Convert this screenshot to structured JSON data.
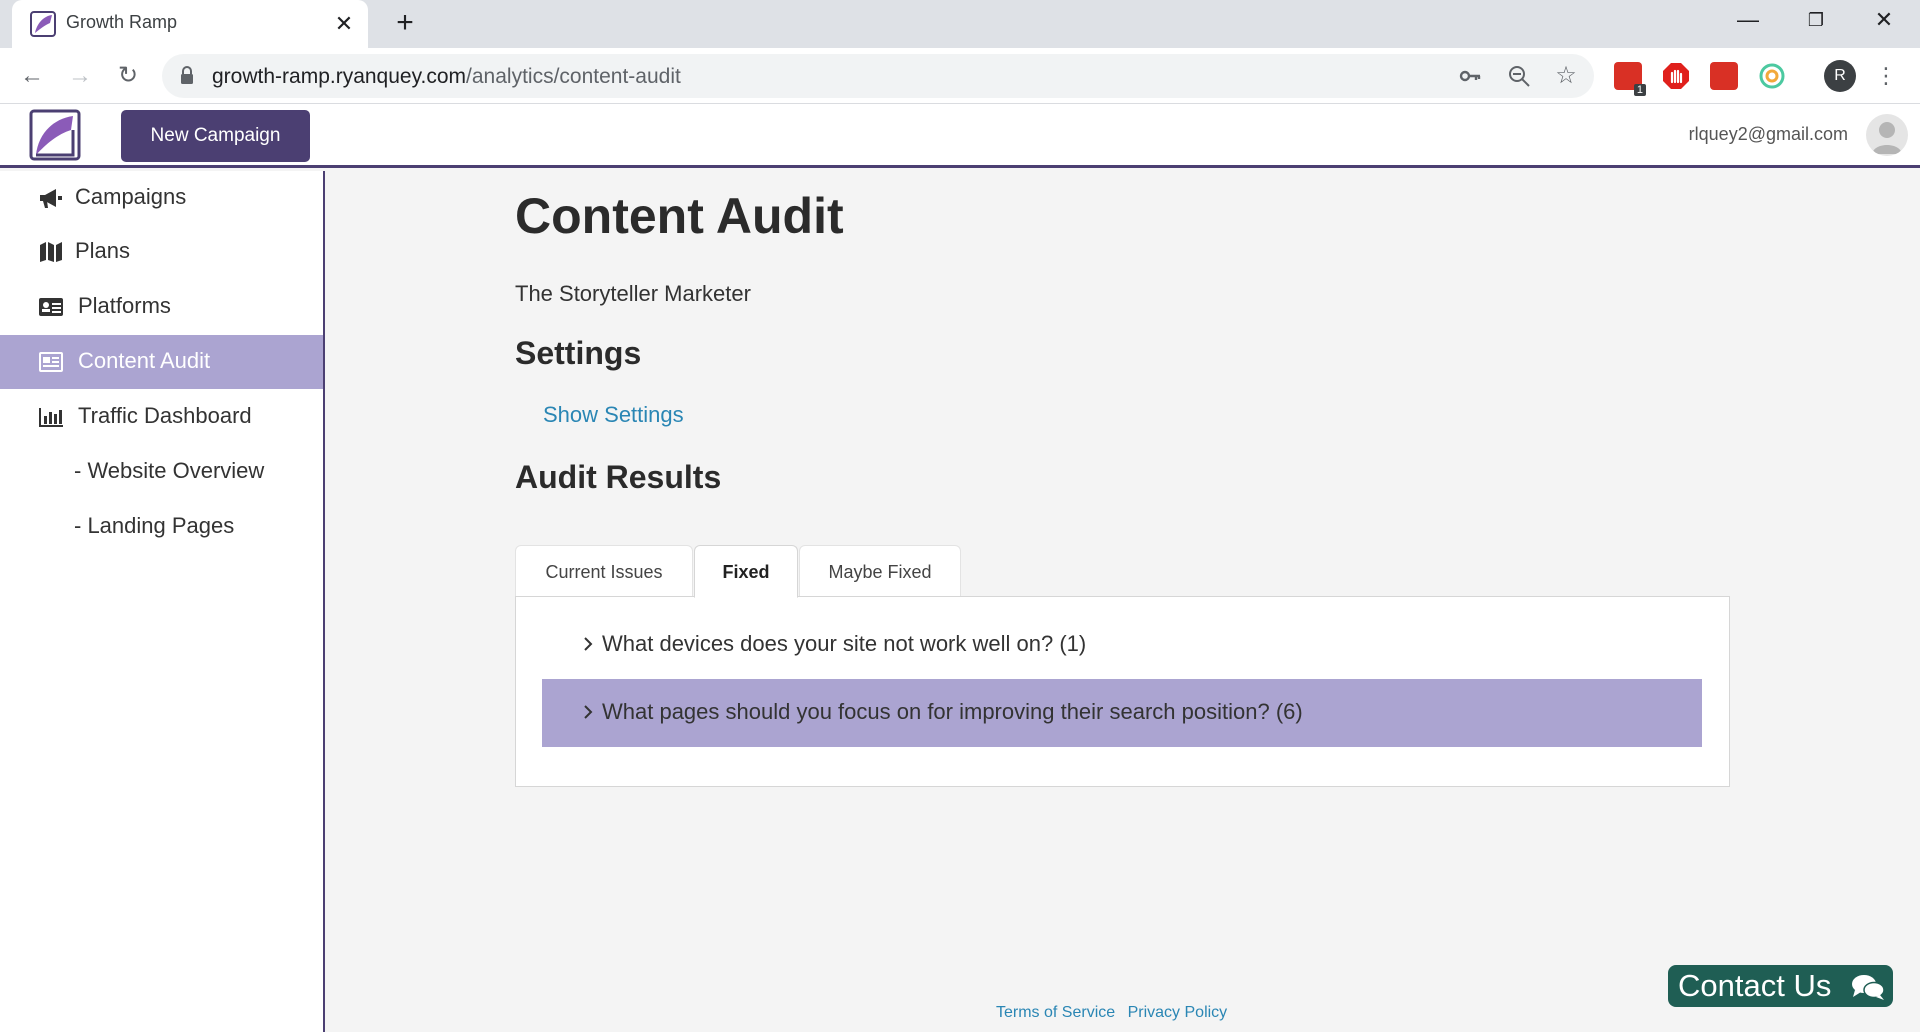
{
  "browser": {
    "tab_title": "Growth Ramp",
    "url_domain": "growth-ramp.ryanquey.com",
    "url_path": "/analytics/content-audit",
    "extension_badge": "1",
    "profile_initial": "R"
  },
  "header": {
    "new_campaign_label": "New Campaign",
    "user_email": "rlquey2@gmail.com"
  },
  "sidebar": {
    "items": [
      {
        "label": "Campaigns",
        "icon": "megaphone-icon"
      },
      {
        "label": "Plans",
        "icon": "map-icon"
      },
      {
        "label": "Platforms",
        "icon": "id-card-icon"
      },
      {
        "label": "Content Audit",
        "icon": "newspaper-icon",
        "active": true
      },
      {
        "label": "Traffic Dashboard",
        "icon": "bar-chart-icon"
      }
    ],
    "subitems": [
      {
        "label": "- Website Overview"
      },
      {
        "label": "- Landing Pages"
      }
    ]
  },
  "main": {
    "title": "Content Audit",
    "site_name": "The Storyteller Marketer",
    "settings_heading": "Settings",
    "show_settings": "Show Settings",
    "audit_heading": "Audit Results",
    "tabs": [
      {
        "label": "Current Issues"
      },
      {
        "label": "Fixed",
        "selected": true
      },
      {
        "label": "Maybe Fixed"
      }
    ],
    "questions": [
      {
        "text": "What devices does your site not work well on? (1)"
      },
      {
        "text": "What pages should you focus on for improving their search position? (6)",
        "highlighted": true
      }
    ]
  },
  "footer": {
    "terms": "Terms of Service",
    "privacy": "Privacy Policy"
  },
  "contact": {
    "label": "Contact Us"
  },
  "colors": {
    "brand": "#4b3f72",
    "active_bg": "#aba4d1",
    "link": "#2a86b4",
    "contact_bg": "#1f5e54"
  }
}
